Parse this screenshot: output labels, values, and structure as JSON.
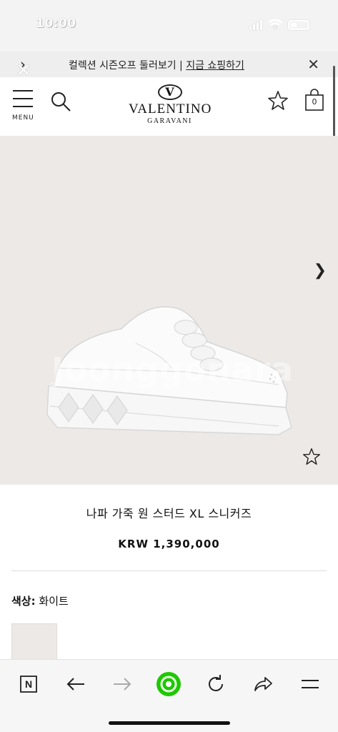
{
  "status_bar": {
    "time": "10:00"
  },
  "promo": {
    "text": "컬렉션 시즌오프 둘러보기 | ",
    "link": "지금 쇼핑하기"
  },
  "header": {
    "menu_label": "MENU",
    "logo_mark": "V",
    "logo_main": "VALENTINO",
    "logo_sub": "GARAVANI",
    "cart_count": "0"
  },
  "product": {
    "watermark": "Joonggonara",
    "name": "나파 가죽 원 스터드 XL 스니커즈",
    "price": "KRW 1,390,000",
    "color_label": "색상:",
    "color_value": "화이트"
  },
  "icons": {
    "menu": "menu-icon",
    "search": "search-icon",
    "wishlist": "star-icon",
    "cart": "shopping-bag-icon",
    "image_next": "chevron-right-icon",
    "browser": [
      "naver-icon",
      "back-arrow-icon",
      "forward-arrow-icon",
      "green-dot-icon",
      "refresh-icon",
      "share-icon",
      "hamburger-icon"
    ]
  },
  "colors": {
    "image_background": "#ede9e6",
    "browser_accent": "#1ec800"
  }
}
